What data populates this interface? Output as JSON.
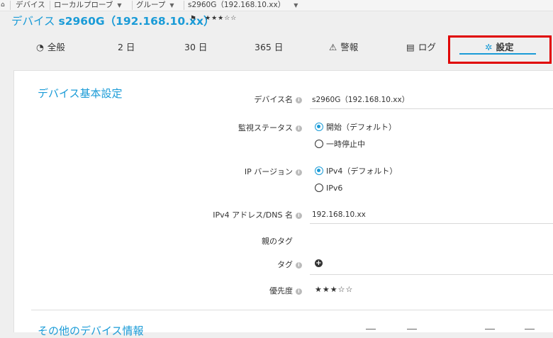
{
  "breadcrumb": {
    "home_icon": "home-icon",
    "items": [
      "デバイス",
      "ローカルプローブ",
      "グループ",
      "s2960G（192.168.10.xx）"
    ]
  },
  "header": {
    "title_prefix": "デバイス",
    "title_name": "s2960G（192.168.10.xx）",
    "flag_icon": "flag-icon",
    "priority_stars": "★★★☆☆"
  },
  "tabs": [
    {
      "label": "全般",
      "icon": "gauge-icon"
    },
    {
      "label": "2 日"
    },
    {
      "label": "30 日"
    },
    {
      "label": "365 日"
    },
    {
      "label": "警報",
      "icon": "warning-icon"
    },
    {
      "label": "ログ",
      "icon": "log-icon"
    },
    {
      "label": "設定",
      "icon": "gear-icon",
      "active": true
    }
  ],
  "colors": {
    "accent": "#1a9bd7",
    "highlight": "#e00000"
  },
  "basic_settings": {
    "title": "デバイス基本設定",
    "device_name": {
      "label": "デバイス名",
      "value": "s2960G（192.168.10.xx）"
    },
    "monitoring_status": {
      "label": "監視ステータス",
      "options": [
        {
          "label": "開始（デフォルト）",
          "selected": true
        },
        {
          "label": "一時停止中",
          "selected": false
        }
      ]
    },
    "ip_version": {
      "label": "IP バージョン",
      "options": [
        {
          "label": "IPv4（デフォルト）",
          "selected": true
        },
        {
          "label": "IPv6",
          "selected": false
        }
      ]
    },
    "address": {
      "label": "IPv4 アドレス/DNS 名",
      "value": "192.168.10.xx"
    },
    "parent_tags": {
      "label": "親のタグ"
    },
    "tags": {
      "label": "タグ"
    },
    "priority": {
      "label": "優先度",
      "stars": "★★★☆☆"
    }
  },
  "other_info": {
    "title": "その他のデバイス情報"
  }
}
